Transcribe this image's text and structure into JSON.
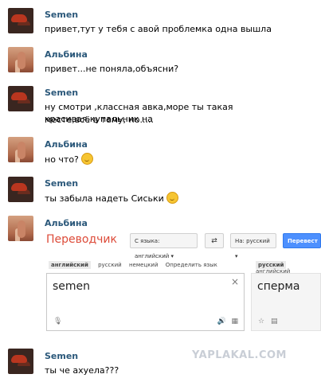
{
  "messages": [
    {
      "author": "Semen",
      "text": "привет,тут у тебя с авой проблемка одна вышла"
    },
    {
      "author": "Альбина",
      "text": "привет...не поняла,объясни?"
    },
    {
      "author": "Semen",
      "text_line1": "ну смотри ,классная авка,море ты такая красивая,купальник на",
      "text_line2": "месте,всё в тему, но....."
    },
    {
      "author": "Альбина",
      "text": "но что?"
    },
    {
      "author": "Semen",
      "text": "ты забыла надеть Сиськи"
    },
    {
      "author": "Альбина"
    },
    {
      "author": "Semen",
      "text": "ты че ахуела???"
    }
  ],
  "translator": {
    "title": "Переводчик",
    "from_button": "С языка: английский",
    "swap_icon": "swap-icon",
    "to_button": "На: русский",
    "translate_button": "Перевест",
    "source_tabs": [
      "английский",
      "русский",
      "немецкий",
      "Определить язык"
    ],
    "target_tabs": [
      "русский",
      "английский"
    ],
    "input_text": "semen",
    "output_text": "сперма",
    "clear_icon": "×"
  },
  "watermark": "YAPLAKAL.COM",
  "colors": {
    "name": "#2b587a",
    "translator_title": "#dd4b39",
    "translate_button": "#4d90fe"
  }
}
